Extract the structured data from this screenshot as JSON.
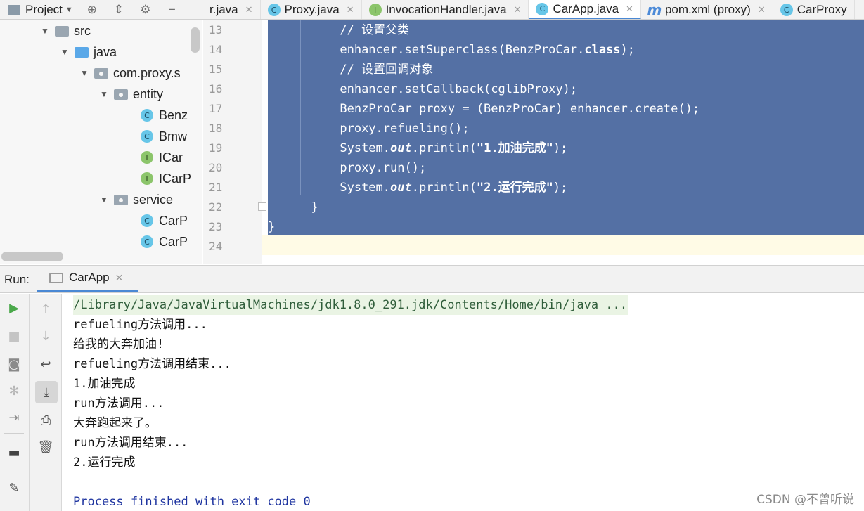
{
  "toolbar": {
    "project_label": "Project"
  },
  "editor_tabs": [
    {
      "label": "r.java",
      "icon": "none"
    },
    {
      "label": "Proxy.java",
      "icon": "C"
    },
    {
      "label": "InvocationHandler.java",
      "icon": "I"
    },
    {
      "label": "CarApp.java",
      "icon": "C",
      "active": true
    },
    {
      "label": "pom.xml (proxy)",
      "icon": "m"
    },
    {
      "label": "CarProxy",
      "icon": "C"
    }
  ],
  "tree": {
    "src": "src",
    "java": "java",
    "pkg": "com.proxy.s",
    "entity": "entity",
    "benz": "Benz",
    "bmw": "Bmw",
    "icar": "ICar",
    "icarp": "ICarP",
    "service": "service",
    "carp1": "CarP",
    "carp2": "CarP"
  },
  "editor": {
    "line_numbers": [
      "13",
      "14",
      "15",
      "16",
      "17",
      "18",
      "19",
      "20",
      "21",
      "22",
      "23",
      "24"
    ],
    "lines": {
      "l13": "// 设置父类",
      "l14a": "enhancer.setSuperclass(BenzProCar.",
      "l14b": "class",
      "l14c": ");",
      "l15": "// 设置回调对象",
      "l16": "enhancer.setCallback(cglibProxy);",
      "l17": "BenzProCar proxy = (BenzProCar) enhancer.create();",
      "l18": "proxy.refueling();",
      "l19a": "System.",
      "l19b": "out",
      "l19c": ".println(",
      "l19d": "\"1.加油完成\"",
      "l19e": ");",
      "l20": "proxy.run();",
      "l21a": "System.",
      "l21b": "out",
      "l21c": ".println(",
      "l21d": "\"2.运行完成\"",
      "l21e": ");",
      "l22": "}",
      "l23": "}"
    },
    "selection_color": "#5470a4"
  },
  "run": {
    "label": "Run:",
    "tab_name": "CarApp",
    "console": {
      "cmd": "/Library/Java/JavaVirtualMachines/jdk1.8.0_291.jdk/Contents/Home/bin/java ...",
      "l1": "refueling方法调用...",
      "l2": "给我的大奔加油!",
      "l3": "refueling方法调用结束...",
      "l4": "1.加油完成",
      "l5": "run方法调用...",
      "l6": "大奔跑起来了。",
      "l7": "run方法调用结束...",
      "l8": "2.运行完成",
      "exit": "Process finished with exit code 0"
    }
  },
  "watermark": "CSDN @不曾听说"
}
